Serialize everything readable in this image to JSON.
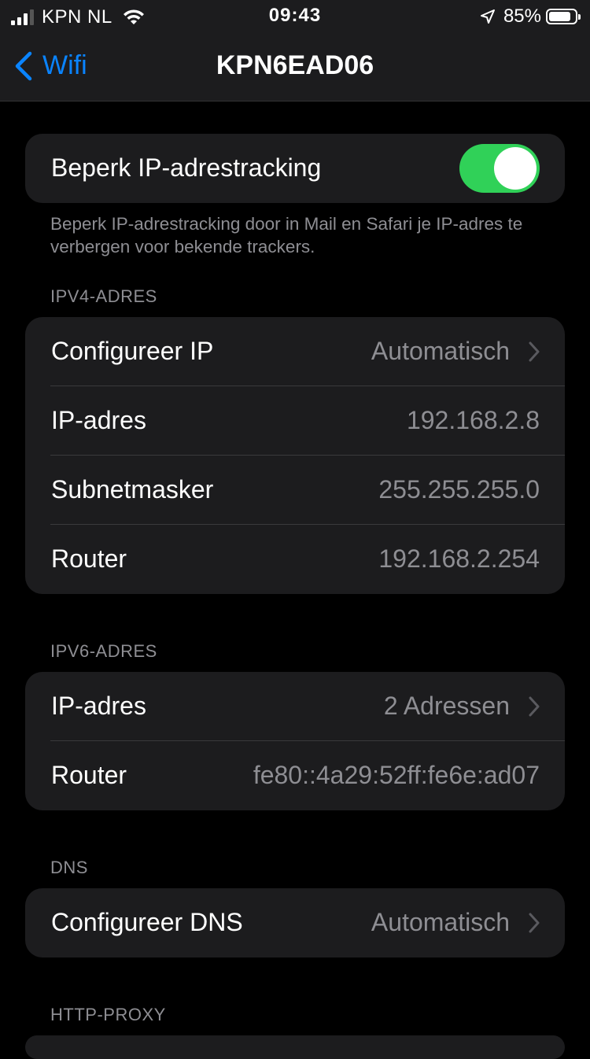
{
  "status_bar": {
    "carrier": "KPN NL",
    "time": "09:43",
    "battery_percent": "85%",
    "battery_level": 0.85,
    "icons": [
      "signal-icon",
      "wifi-icon",
      "location-icon",
      "battery-icon"
    ]
  },
  "nav": {
    "back_label": "Wifi",
    "title": "KPN6EAD06",
    "accent_color": "#0a84ff"
  },
  "limit_tracking": {
    "label": "Beperk IP-adrestracking",
    "enabled": true,
    "toggle_color": "#30d158",
    "footnote": "Beperk IP-adrestracking door in Mail en Safari je IP-adres te verbergen voor bekende trackers."
  },
  "ipv4": {
    "header": "IPV4-ADRES",
    "rows": [
      {
        "label": "Configureer IP",
        "value": "Automatisch"
      },
      {
        "label": "IP-adres",
        "value": "192.168.2.8"
      },
      {
        "label": "Subnetmasker",
        "value": "255.255.255.0"
      },
      {
        "label": "Router",
        "value": "192.168.2.254"
      }
    ]
  },
  "ipv6": {
    "header": "IPV6-ADRES",
    "rows": [
      {
        "label": "IP-adres",
        "value": "2 Adressen"
      },
      {
        "label": "Router",
        "value": "fe80::4a29:52ff:fe6e:ad07"
      }
    ]
  },
  "dns": {
    "header": "DNS",
    "rows": [
      {
        "label": "Configureer DNS",
        "value": "Automatisch"
      }
    ]
  },
  "http_proxy": {
    "header": "HTTP-PROXY"
  }
}
